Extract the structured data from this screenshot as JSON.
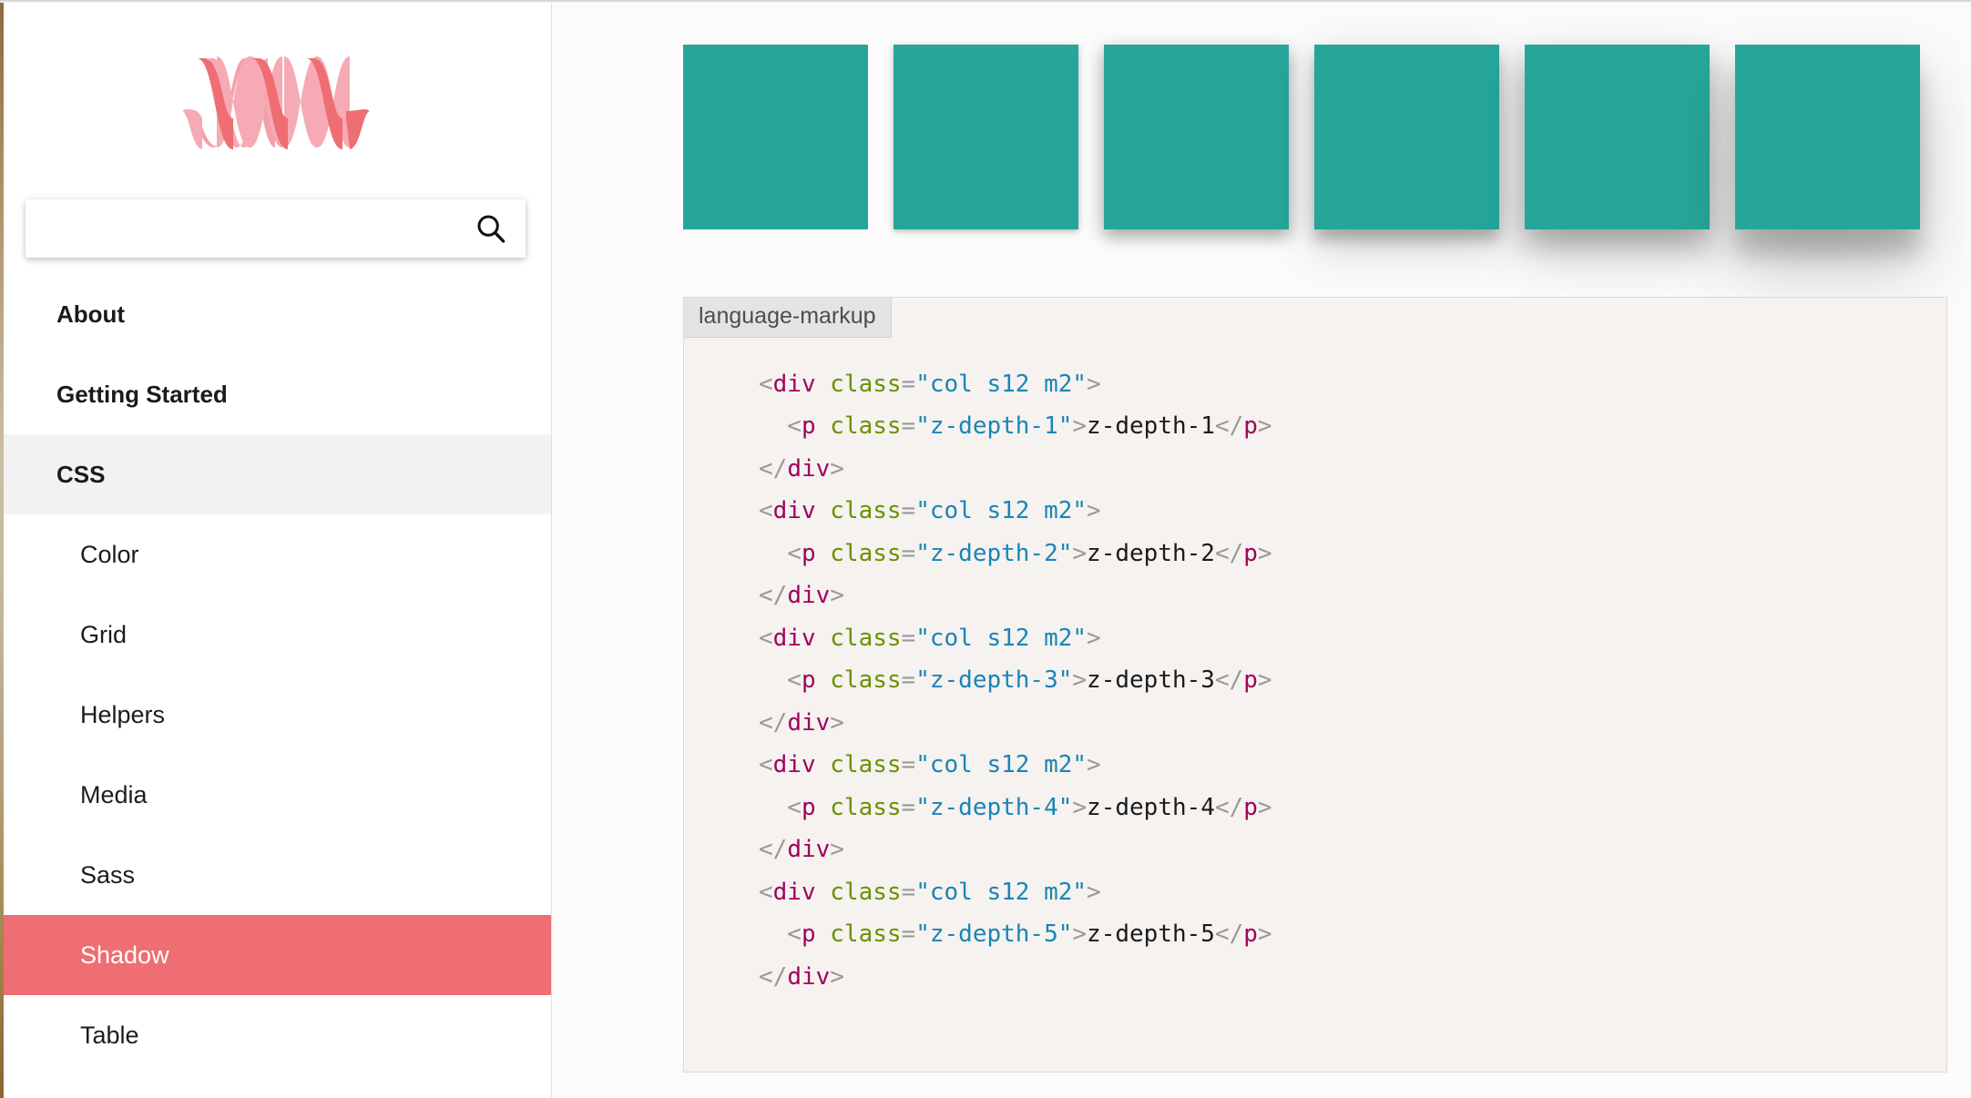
{
  "sidebar": {
    "logo_name": "materialize-logo",
    "logo_colors": {
      "light": "#f49aa4",
      "dark": "#ee6e73"
    },
    "search": {
      "value": "",
      "placeholder": "",
      "icon": "search-icon"
    },
    "items": [
      {
        "label": "About",
        "type": "group",
        "state": "closed",
        "active": false
      },
      {
        "label": "Getting Started",
        "type": "group",
        "state": "closed",
        "active": false
      },
      {
        "label": "CSS",
        "type": "group",
        "state": "open",
        "active": false
      },
      {
        "label": "Color",
        "type": "sub",
        "active": false
      },
      {
        "label": "Grid",
        "type": "sub",
        "active": false
      },
      {
        "label": "Helpers",
        "type": "sub",
        "active": false
      },
      {
        "label": "Media",
        "type": "sub",
        "active": false
      },
      {
        "label": "Sass",
        "type": "sub",
        "active": false
      },
      {
        "label": "Shadow",
        "type": "sub",
        "active": true
      },
      {
        "label": "Table",
        "type": "sub",
        "active": false
      }
    ]
  },
  "main": {
    "demo": {
      "box_color": "#26a69a",
      "boxes": [
        {
          "name": "z-depth-0",
          "depth": 0
        },
        {
          "name": "z-depth-1",
          "depth": 1
        },
        {
          "name": "z-depth-2",
          "depth": 2
        },
        {
          "name": "z-depth-3",
          "depth": 3
        },
        {
          "name": "z-depth-4",
          "depth": 4
        },
        {
          "name": "z-depth-5",
          "depth": 5
        }
      ]
    },
    "code": {
      "language_label": "language-markup",
      "lines": [
        [
          {
            "t": "punct",
            "v": "<"
          },
          {
            "t": "tag",
            "v": "div"
          },
          {
            "t": "attr",
            "v": " class"
          },
          {
            "t": "punct",
            "v": "="
          },
          {
            "t": "str",
            "v": "\"col s12 m2\""
          },
          {
            "t": "punct",
            "v": ">"
          }
        ],
        [
          {
            "t": "punct",
            "v": "  <"
          },
          {
            "t": "tag",
            "v": "p"
          },
          {
            "t": "attr",
            "v": " class"
          },
          {
            "t": "punct",
            "v": "="
          },
          {
            "t": "str",
            "v": "\"z-depth-1\""
          },
          {
            "t": "punct",
            "v": ">"
          },
          {
            "t": "text",
            "v": "z-depth-1"
          },
          {
            "t": "punct",
            "v": "</"
          },
          {
            "t": "tag",
            "v": "p"
          },
          {
            "t": "punct",
            "v": ">"
          }
        ],
        [
          {
            "t": "punct",
            "v": "</"
          },
          {
            "t": "tag",
            "v": "div"
          },
          {
            "t": "punct",
            "v": ">"
          }
        ],
        [
          {
            "t": "punct",
            "v": "<"
          },
          {
            "t": "tag",
            "v": "div"
          },
          {
            "t": "attr",
            "v": " class"
          },
          {
            "t": "punct",
            "v": "="
          },
          {
            "t": "str",
            "v": "\"col s12 m2\""
          },
          {
            "t": "punct",
            "v": ">"
          }
        ],
        [
          {
            "t": "punct",
            "v": "  <"
          },
          {
            "t": "tag",
            "v": "p"
          },
          {
            "t": "attr",
            "v": " class"
          },
          {
            "t": "punct",
            "v": "="
          },
          {
            "t": "str",
            "v": "\"z-depth-2\""
          },
          {
            "t": "punct",
            "v": ">"
          },
          {
            "t": "text",
            "v": "z-depth-2"
          },
          {
            "t": "punct",
            "v": "</"
          },
          {
            "t": "tag",
            "v": "p"
          },
          {
            "t": "punct",
            "v": ">"
          }
        ],
        [
          {
            "t": "punct",
            "v": "</"
          },
          {
            "t": "tag",
            "v": "div"
          },
          {
            "t": "punct",
            "v": ">"
          }
        ],
        [
          {
            "t": "punct",
            "v": "<"
          },
          {
            "t": "tag",
            "v": "div"
          },
          {
            "t": "attr",
            "v": " class"
          },
          {
            "t": "punct",
            "v": "="
          },
          {
            "t": "str",
            "v": "\"col s12 m2\""
          },
          {
            "t": "punct",
            "v": ">"
          }
        ],
        [
          {
            "t": "punct",
            "v": "  <"
          },
          {
            "t": "tag",
            "v": "p"
          },
          {
            "t": "attr",
            "v": " class"
          },
          {
            "t": "punct",
            "v": "="
          },
          {
            "t": "str",
            "v": "\"z-depth-3\""
          },
          {
            "t": "punct",
            "v": ">"
          },
          {
            "t": "text",
            "v": "z-depth-3"
          },
          {
            "t": "punct",
            "v": "</"
          },
          {
            "t": "tag",
            "v": "p"
          },
          {
            "t": "punct",
            "v": ">"
          }
        ],
        [
          {
            "t": "punct",
            "v": "</"
          },
          {
            "t": "tag",
            "v": "div"
          },
          {
            "t": "punct",
            "v": ">"
          }
        ],
        [
          {
            "t": "punct",
            "v": "<"
          },
          {
            "t": "tag",
            "v": "div"
          },
          {
            "t": "attr",
            "v": " class"
          },
          {
            "t": "punct",
            "v": "="
          },
          {
            "t": "str",
            "v": "\"col s12 m2\""
          },
          {
            "t": "punct",
            "v": ">"
          }
        ],
        [
          {
            "t": "punct",
            "v": "  <"
          },
          {
            "t": "tag",
            "v": "p"
          },
          {
            "t": "attr",
            "v": " class"
          },
          {
            "t": "punct",
            "v": "="
          },
          {
            "t": "str",
            "v": "\"z-depth-4\""
          },
          {
            "t": "punct",
            "v": ">"
          },
          {
            "t": "text",
            "v": "z-depth-4"
          },
          {
            "t": "punct",
            "v": "</"
          },
          {
            "t": "tag",
            "v": "p"
          },
          {
            "t": "punct",
            "v": ">"
          }
        ],
        [
          {
            "t": "punct",
            "v": "</"
          },
          {
            "t": "tag",
            "v": "div"
          },
          {
            "t": "punct",
            "v": ">"
          }
        ],
        [
          {
            "t": "punct",
            "v": "<"
          },
          {
            "t": "tag",
            "v": "div"
          },
          {
            "t": "attr",
            "v": " class"
          },
          {
            "t": "punct",
            "v": "="
          },
          {
            "t": "str",
            "v": "\"col s12 m2\""
          },
          {
            "t": "punct",
            "v": ">"
          }
        ],
        [
          {
            "t": "punct",
            "v": "  <"
          },
          {
            "t": "tag",
            "v": "p"
          },
          {
            "t": "attr",
            "v": " class"
          },
          {
            "t": "punct",
            "v": "="
          },
          {
            "t": "str",
            "v": "\"z-depth-5\""
          },
          {
            "t": "punct",
            "v": ">"
          },
          {
            "t": "text",
            "v": "z-depth-5"
          },
          {
            "t": "punct",
            "v": "</"
          },
          {
            "t": "tag",
            "v": "p"
          },
          {
            "t": "punct",
            "v": ">"
          }
        ],
        [
          {
            "t": "punct",
            "v": "</"
          },
          {
            "t": "tag",
            "v": "div"
          },
          {
            "t": "punct",
            "v": ">"
          }
        ]
      ]
    }
  }
}
